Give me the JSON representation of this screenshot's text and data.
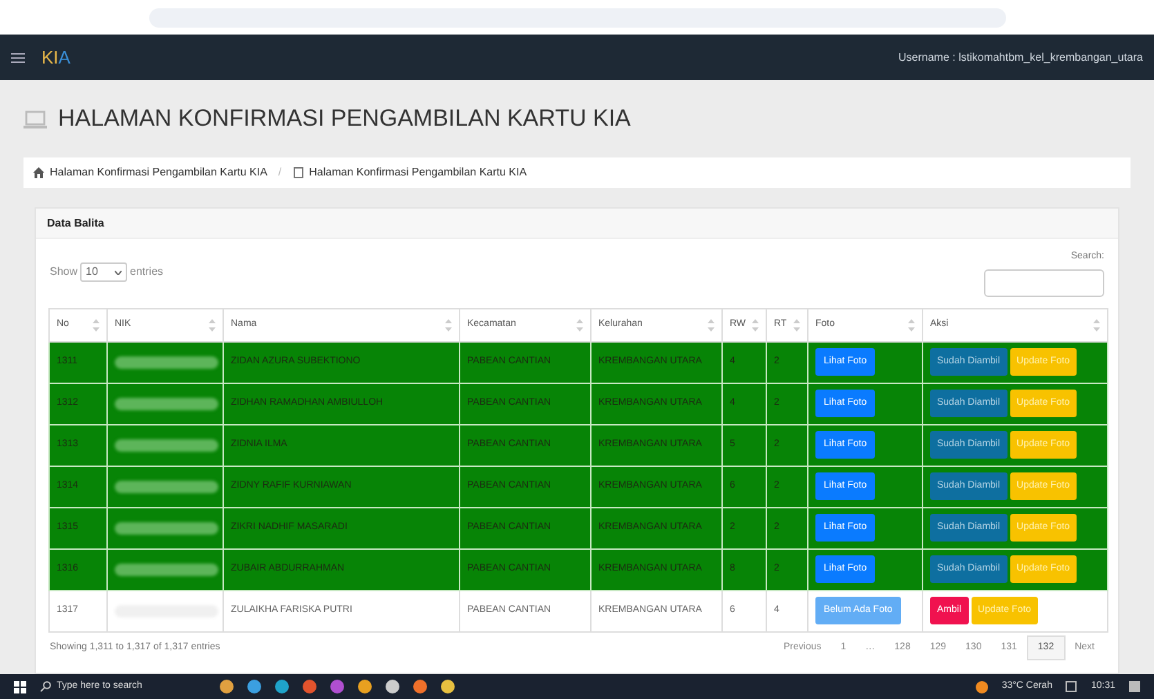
{
  "navbar": {
    "brand_first": "KI",
    "brand_second": "A",
    "user": "Username : lstikomahtbm_kel_krembangan_utara"
  },
  "page_title": "HALAMAN KONFIRMASI PENGAMBILAN KARTU KIA",
  "breadcrumb_separator": "/",
  "breadcrumb": [
    "Halaman Konfirmasi Pengambilan Kartu KIA",
    "Halaman Konfirmasi Pengambilan Kartu KIA"
  ],
  "card_title": "Data Balita",
  "length": {
    "show": "Show",
    "value": "10",
    "entries": "entries"
  },
  "search": {
    "label": "Search:"
  },
  "table": {
    "columns": [
      "No",
      "NIK",
      "Nama",
      "Kecamatan",
      "Kelurahan",
      "RW",
      "RT",
      "Foto",
      "Aksi"
    ],
    "rows": [
      {
        "no": "1311",
        "nama": "ZIDAN AZURA SUBEKTIONO",
        "kecamatan": "PABEAN CANTIAN",
        "kelurahan": "KREMBANGAN UTARA",
        "rw": "4",
        "rt": "2",
        "taken": true,
        "foto": "Lihat Foto",
        "status": "Sudah Diambil",
        "update": "Update Foto"
      },
      {
        "no": "1312",
        "nama": "ZIDHAN RAMADHAN AMBIULLOH",
        "kecamatan": "PABEAN CANTIAN",
        "kelurahan": "KREMBANGAN UTARA",
        "rw": "4",
        "rt": "2",
        "taken": true,
        "foto": "Lihat Foto",
        "status": "Sudah Diambil",
        "update": "Update Foto"
      },
      {
        "no": "1313",
        "nama": "ZIDNIA ILMA",
        "kecamatan": "PABEAN CANTIAN",
        "kelurahan": "KREMBANGAN UTARA",
        "rw": "5",
        "rt": "2",
        "taken": true,
        "foto": "Lihat Foto",
        "status": "Sudah Diambil",
        "update": "Update Foto"
      },
      {
        "no": "1314",
        "nama": "ZIDNY RAFIF KURNIAWAN",
        "kecamatan": "PABEAN CANTIAN",
        "kelurahan": "KREMBANGAN UTARA",
        "rw": "6",
        "rt": "2",
        "taken": true,
        "foto": "Lihat Foto",
        "status": "Sudah Diambil",
        "update": "Update Foto"
      },
      {
        "no": "1315",
        "nama": "ZIKRI NADHIF MASARADI",
        "kecamatan": "PABEAN CANTIAN",
        "kelurahan": "KREMBANGAN UTARA",
        "rw": "2",
        "rt": "2",
        "taken": true,
        "foto": "Lihat Foto",
        "status": "Sudah Diambil",
        "update": "Update Foto"
      },
      {
        "no": "1316",
        "nama": "ZUBAIR ABDURRAHMAN",
        "kecamatan": "PABEAN CANTIAN",
        "kelurahan": "KREMBANGAN UTARA",
        "rw": "8",
        "rt": "2",
        "taken": true,
        "foto": "Lihat Foto",
        "status": "Sudah Diambil",
        "update": "Update Foto"
      },
      {
        "no": "1317",
        "nama": "ZULAIKHA FARISKA PUTRI",
        "kecamatan": "PABEAN CANTIAN",
        "kelurahan": "KREMBANGAN UTARA",
        "rw": "6",
        "rt": "4",
        "taken": false,
        "foto": "Belum Ada Foto",
        "status": "Ambil",
        "update": "Update Foto"
      }
    ]
  },
  "info": "Showing 1,311 to 1,317 of 1,317 entries",
  "pagination": [
    {
      "label": "Previous",
      "selected": false
    },
    {
      "label": "1",
      "selected": false
    },
    {
      "label": "…",
      "selected": false
    },
    {
      "label": "128",
      "selected": false
    },
    {
      "label": "129",
      "selected": false
    },
    {
      "label": "130",
      "selected": false
    },
    {
      "label": "131",
      "selected": false
    },
    {
      "label": "132",
      "selected": true
    },
    {
      "label": "Next",
      "selected": false
    }
  ],
  "taskbar": {
    "search_placeholder": "Type here to search",
    "weather": "33°C Cerah",
    "time": "10:31"
  }
}
